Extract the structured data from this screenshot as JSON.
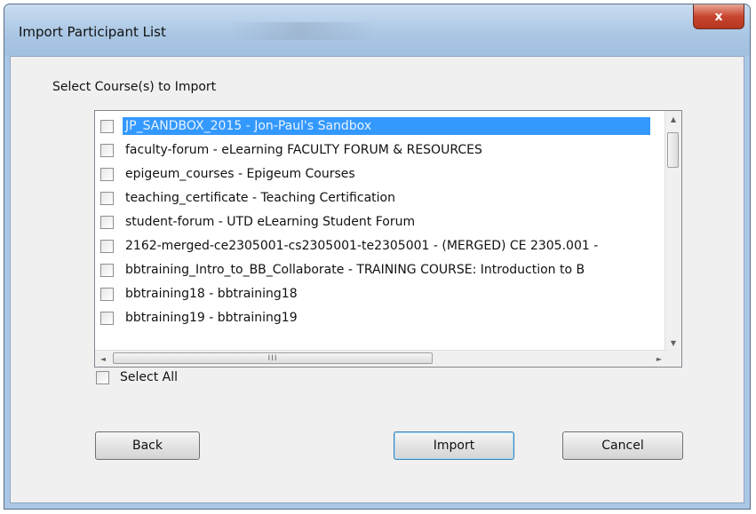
{
  "window": {
    "title": "Import Participant List",
    "close_glyph": "x"
  },
  "section_label": "Select Course(s) to Import",
  "courses": [
    {
      "label": "JP_SANDBOX_2015 - Jon-Paul's Sandbox",
      "selected": true,
      "checked": false
    },
    {
      "label": "faculty-forum - eLearning FACULTY FORUM & RESOURCES",
      "selected": false,
      "checked": false
    },
    {
      "label": "epigeum_courses - Epigeum Courses",
      "selected": false,
      "checked": false
    },
    {
      "label": "teaching_certificate - Teaching Certification",
      "selected": false,
      "checked": false
    },
    {
      "label": "student-forum - UTD eLearning Student Forum",
      "selected": false,
      "checked": false
    },
    {
      "label": "2162-merged-ce2305001-cs2305001-te2305001 - (MERGED) CE 2305.001 -",
      "selected": false,
      "checked": false
    },
    {
      "label": "bbtraining_Intro_to_BB_Collaborate - TRAINING COURSE: Introduction to B",
      "selected": false,
      "checked": false
    },
    {
      "label": "bbtraining18 - bbtraining18",
      "selected": false,
      "checked": false
    },
    {
      "label": "bbtraining19 - bbtraining19",
      "selected": false,
      "checked": false
    }
  ],
  "scroll": {
    "up": "▲",
    "down": "▼",
    "left": "◄",
    "right": "►",
    "thumb_grip": "III"
  },
  "select_all": {
    "label": "Select All",
    "checked": false
  },
  "buttons": {
    "back": "Back",
    "import": "Import",
    "cancel": "Cancel"
  }
}
